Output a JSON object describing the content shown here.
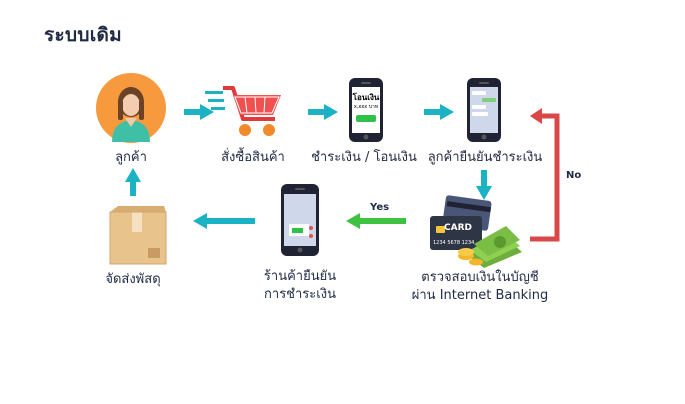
{
  "title": "ระบบเดิม",
  "steps": {
    "customer": "ลูกค้า",
    "order": "สั่งซื้อสินค้า",
    "pay": "ชำระเงิน / โอนเงิน",
    "confirm": "ลูกค้ายืนยันชำระเงิน",
    "verify_line1": "ตรวจสอบเงินในบัญชี",
    "verify_line2": "ผ่าน Internet Banking",
    "shop_line1": "ร้านค้ายืนยัน",
    "shop_line2": "การชำระเงิน",
    "ship": "จัดส่งพัสดุ"
  },
  "branch": {
    "yes": "Yes",
    "no": "No"
  },
  "phone_screen": {
    "heading": "โอนเงิน",
    "amount": "x,xxx บาท"
  },
  "card": {
    "brand": "CARD",
    "number": "1234 5678 1234"
  },
  "colors": {
    "arrow": "#1ab2c4",
    "yes": "#3fc241",
    "no": "#d94848",
    "text": "#1f2a44"
  }
}
